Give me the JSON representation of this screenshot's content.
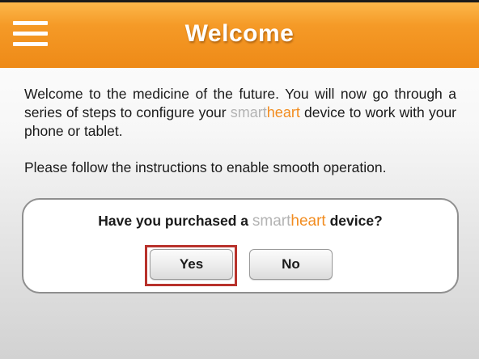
{
  "header": {
    "title": "Welcome",
    "menu_icon": "hamburger-menu-icon",
    "background_color": "#f39320"
  },
  "brand": {
    "part1": "smart",
    "part2": "heart",
    "part1_color": "#b3b3b3",
    "part2_color": "#f28c1f"
  },
  "content": {
    "intro_before_brand": "Welcome to the medicine of the future. You will now go through a series of steps to configure your ",
    "intro_after_brand": " device to work with your phone or tablet.",
    "instructions": "Please follow the instructions to enable smooth operation."
  },
  "question": {
    "text_before_brand": "Have you purchased a ",
    "text_after_brand": " device?",
    "yes_label": "Yes",
    "no_label": "No",
    "highlight_color": "#b8322c"
  }
}
